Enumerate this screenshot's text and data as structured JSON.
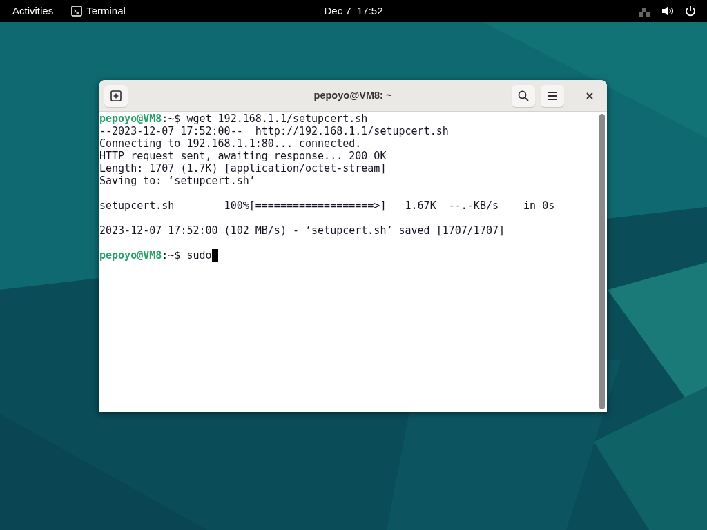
{
  "top_bar": {
    "activities": "Activities",
    "app_name": "Terminal",
    "clock": "Dec 7  17:52"
  },
  "window": {
    "title": "pepoyo@VM8: ~"
  },
  "terminal": {
    "lines": [
      {
        "kind": "prompt",
        "user": "pepoyo@VM8",
        "path": ":~$",
        "command": "wget 192.168.1.1/setupcert.sh",
        "cursor": false
      },
      {
        "kind": "output",
        "text": "--2023-12-07 17:52:00--  http://192.168.1.1/setupcert.sh"
      },
      {
        "kind": "output",
        "text": "Connecting to 192.168.1.1:80... connected."
      },
      {
        "kind": "output",
        "text": "HTTP request sent, awaiting response... 200 OK"
      },
      {
        "kind": "output",
        "text": "Length: 1707 (1.7K) [application/octet-stream]"
      },
      {
        "kind": "output",
        "text": "Saving to: ‘setupcert.sh’"
      },
      {
        "kind": "blank"
      },
      {
        "kind": "output",
        "text": "setupcert.sh        100%[===================>]   1.67K  --.-KB/s    in 0s"
      },
      {
        "kind": "blank"
      },
      {
        "kind": "output",
        "text": "2023-12-07 17:52:00 (102 MB/s) - ‘setupcert.sh’ saved [1707/1707]"
      },
      {
        "kind": "blank"
      },
      {
        "kind": "prompt",
        "user": "pepoyo@VM8",
        "path": ":~$",
        "command": "sudo",
        "cursor": true
      }
    ]
  }
}
